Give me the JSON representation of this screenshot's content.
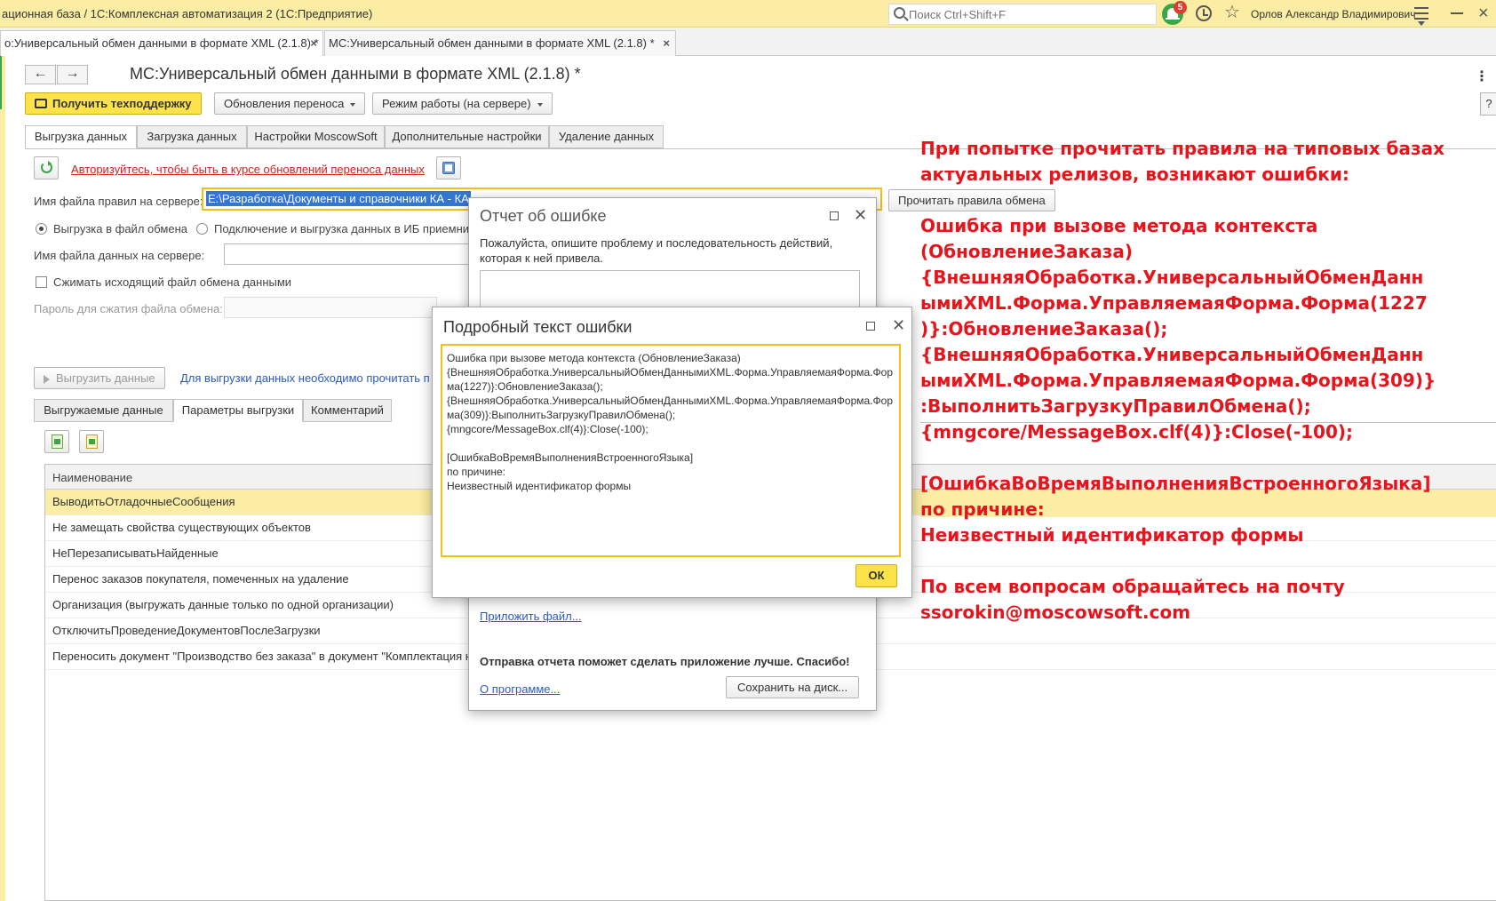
{
  "titlebar": {
    "app_title": "ационная база / 1С:Комплексная автоматизация 2  (1С:Предприятие)",
    "search_placeholder": "Поиск Ctrl+Shift+F",
    "notifications_count": "5",
    "user_name": "Орлов Александр Владимирович"
  },
  "doc_tabs": [
    {
      "label": "о:Универсальный обмен данными в формате XML (2.1.8) *",
      "close": "×"
    },
    {
      "label": "МС:Универсальный обмен данными в формате XML (2.1.8) *",
      "close": "×"
    }
  ],
  "form": {
    "title": "МС:Универсальный обмен данными в формате XML (2.1.8) *",
    "nav_back": "←",
    "nav_forward": "→",
    "kebab": "⋮",
    "help": "?",
    "support_button": "Получить техподдержку",
    "updates_button": "Обновления переноса",
    "mode_button": "Режим работы (на сервере)"
  },
  "tabs": [
    "Выгрузка данных",
    "Загрузка данных",
    "Настройки MoscowSoft",
    "Дополнительные настройки",
    "Удаление данных"
  ],
  "export": {
    "auth_link": "Авторизуйтесь, чтобы быть в курсе обновлений переноса данных",
    "rules_file_label": "Имя файла правил на сервере:",
    "rules_file_value": "E:\\Разработка\\Документы и справочники КА - КА",
    "read_rules_button": "Прочитать правила обмена",
    "radio_export_file": "Выгрузка в файл обмена",
    "radio_connect": "Подключение и выгрузка данных в ИБ приемни",
    "data_file_label": "Имя файла данных на сервере:",
    "compress_label": "Сжимать исходящий файл обмена данными",
    "password_label": "Пароль для сжатия файла обмена:",
    "export_button": "Выгрузить данные",
    "export_hint": "Для выгрузки данных необходимо прочитать п"
  },
  "subtabs": [
    "Выгружаемые данные",
    "Параметры выгрузки",
    "Комментарий"
  ],
  "table": {
    "header": "Наименование",
    "rows": [
      "ВыводитьОтладочныеСообщения",
      "Не замещать свойства существующих объектов",
      "НеПерезаписыватьНайденные",
      "Перенос заказов покупателя, помеченных на удаление",
      "Организация (выгружать данные только по одной организации)",
      "ОтключитьПроведениеДокументовПослеЗагрузки",
      "Переносить документ \"Производство без заказа\" в документ \"Комплектация н"
    ]
  },
  "error_report": {
    "title": "Отчет об ошибке",
    "description": "Пожалуйста, опишите проблему и последовательность действий, которая к ней привела.",
    "attach_link": "Приложить файл...",
    "thanks": "Отправка отчета поможет сделать приложение лучше. Спасибо!",
    "about_link": "О программе...",
    "save_button": "Сохранить на диск..."
  },
  "error_detail": {
    "title": "Подробный текст ошибки",
    "text": "Ошибка при вызове метода контекста (ОбновлениеЗаказа)\n{ВнешняяОбработка.УниверсальныйОбменДаннымиXML.Форма.УправляемаяФорма.Форма(1227)}:ОбновлениеЗаказа();\n{ВнешняяОбработка.УниверсальныйОбменДаннымиXML.Форма.УправляемаяФорма.Форма(309)}:ВыполнитьЗагрузкуПравилОбмена();\n{mngcore/MessageBox.clf(4)}:Close(-100);\n\n[ОшибкаВоВремяВыполненияВстроенногоЯзыка]\nпо причине:\nНеизвестный идентификатор формы",
    "ok_button": "ОК"
  },
  "annotation": {
    "lines": [
      "При попытке прочитать правила на типовых базах",
      "актуальных релизов, возникают ошибки:",
      "",
      "Ошибка при вызове метода контекста",
      "(ОбновлениеЗаказа)",
      "{ВнешняяОбработка.УниверсальныйОбменДанн",
      "ымиXML.Форма.УправляемаяФорма.Форма(1227",
      ")}:ОбновлениеЗаказа();",
      "{ВнешняяОбработка.УниверсальныйОбменДанн",
      "ымиXML.Форма.УправляемаяФорма.Форма(309)}",
      ":ВыполнитьЗагрузкуПравилОбмена();",
      "{mngcore/MessageBox.clf(4)}:Close(-100);",
      "",
      "[ОшибкаВоВремяВыполненияВстроенногоЯзыка]",
      "по причине:",
      "Неизвестный идентификатор формы",
      "",
      "По всем вопросам обращайтесь на почту",
      "ssorokin@moscowsoft.com"
    ]
  },
  "colors": {
    "accent_yellow": "#fbeda3",
    "button_yellow": "#fde24a",
    "annotation_red": "#e8141c",
    "link_red": "#d42020",
    "link_blue": "#2b59c3"
  }
}
